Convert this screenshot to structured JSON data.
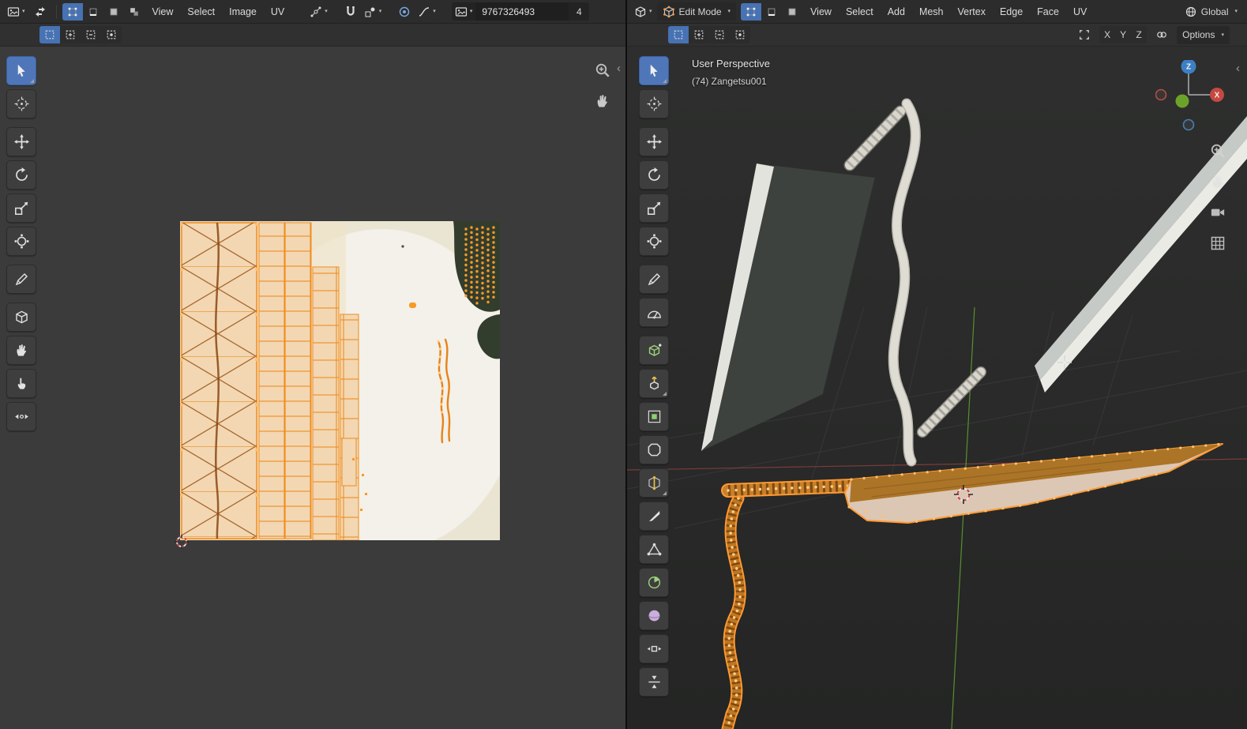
{
  "uv_editor": {
    "header": {
      "menus": [
        "View",
        "Select",
        "Image",
        "UV"
      ],
      "image_name": "9767326493",
      "image_users": "4"
    }
  },
  "viewport": {
    "header": {
      "mode": "Edit Mode",
      "menus": [
        "View",
        "Select",
        "Add",
        "Mesh",
        "Vertex",
        "Edge",
        "Face",
        "UV"
      ],
      "orientation": "Global"
    },
    "subheader": {
      "axis_toggles": [
        "X",
        "Y",
        "Z"
      ],
      "options_label": "Options"
    },
    "overlay": {
      "view_label": "User Perspective",
      "object_label": "(74) Zangetsu001"
    },
    "gizmo": {
      "z": "Z",
      "x": "X"
    }
  },
  "colors": {
    "active_tool_blue": "#4772b3",
    "selection_orange": "#ff9a33",
    "selected_face_fill": "#ab7427"
  }
}
